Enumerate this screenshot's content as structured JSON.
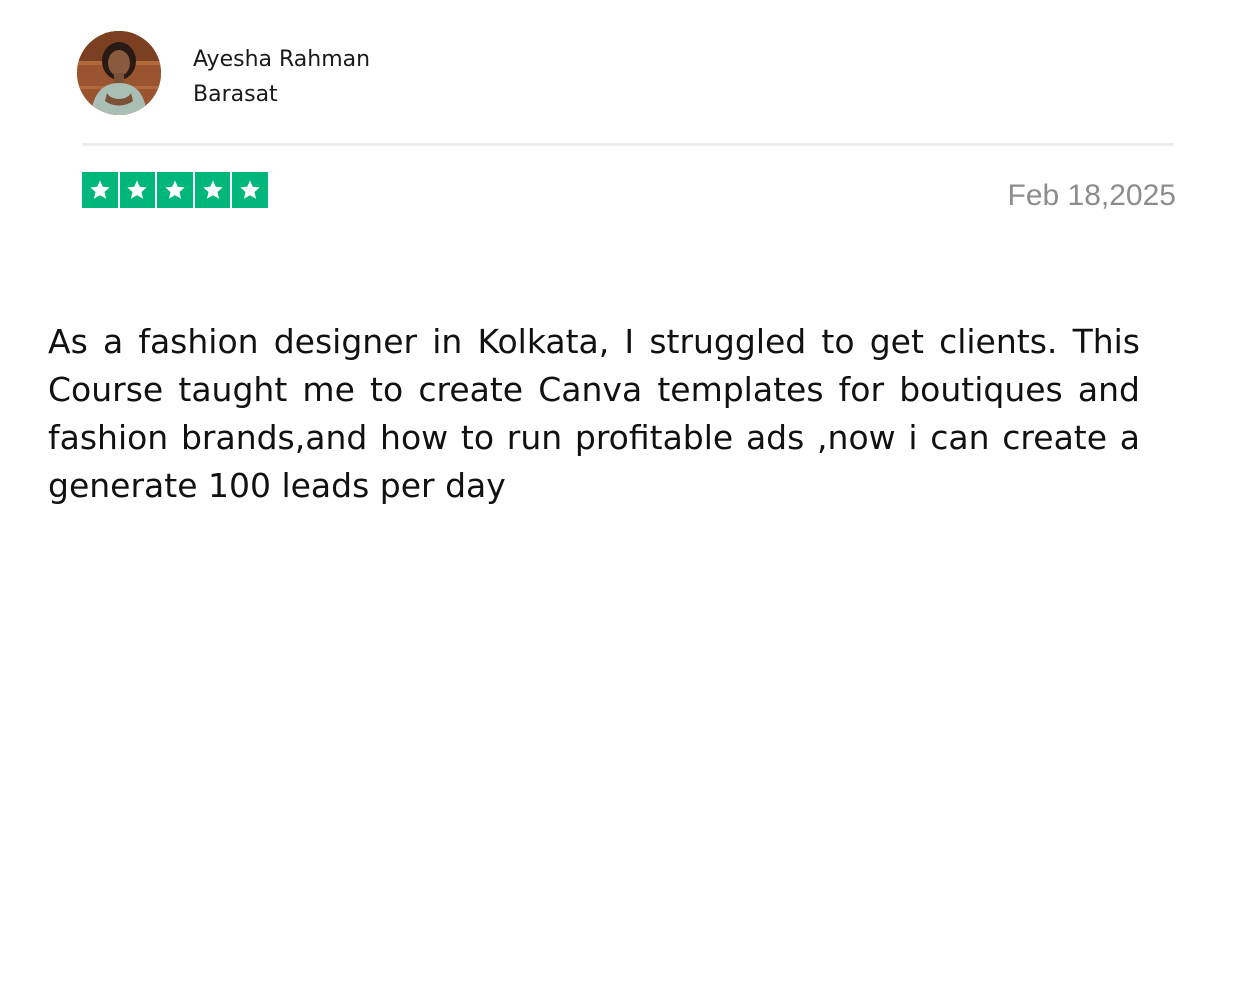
{
  "reviewer": {
    "name": "Ayesha Rahman",
    "location": "Barasat",
    "avatar_icon": "user-avatar-photo"
  },
  "rating": {
    "stars": 5,
    "max": 5,
    "star_color": "#00b67a",
    "star_icon": "star-icon"
  },
  "review": {
    "date": "Feb 18,2025",
    "text": "As a fashion designer in Kolkata, I struggled to get clients. This Course taught me to create Canva templates for boutiques and fashion brands,and how to run profitable ads ,now i can create a generate 100 leads per day"
  },
  "colors": {
    "date_text": "#8c8c8c",
    "divider": "#ececec",
    "body_text": "#111111"
  }
}
